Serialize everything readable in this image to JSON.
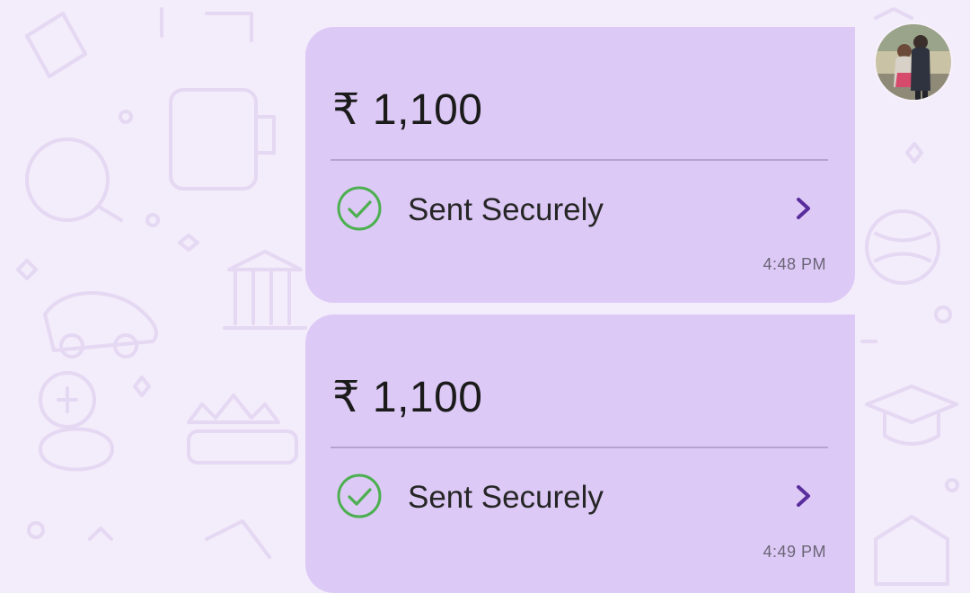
{
  "colors": {
    "background": "#f3ecfa",
    "bubble": "#ddc9f6",
    "check_green": "#4caf50",
    "chevron_purple": "#5a2d9c"
  },
  "messages": [
    {
      "amount": "₹ 1,100",
      "status": "Sent Securely",
      "status_icon": "check-circle-icon",
      "action_icon": "chevron-right-icon",
      "time": "4:48 PM"
    },
    {
      "amount": "₹ 1,100",
      "status": "Sent Securely",
      "status_icon": "check-circle-icon",
      "action_icon": "chevron-right-icon",
      "time": "4:49 PM"
    }
  ],
  "sender": {
    "avatar_icon": "user-photo-avatar"
  }
}
